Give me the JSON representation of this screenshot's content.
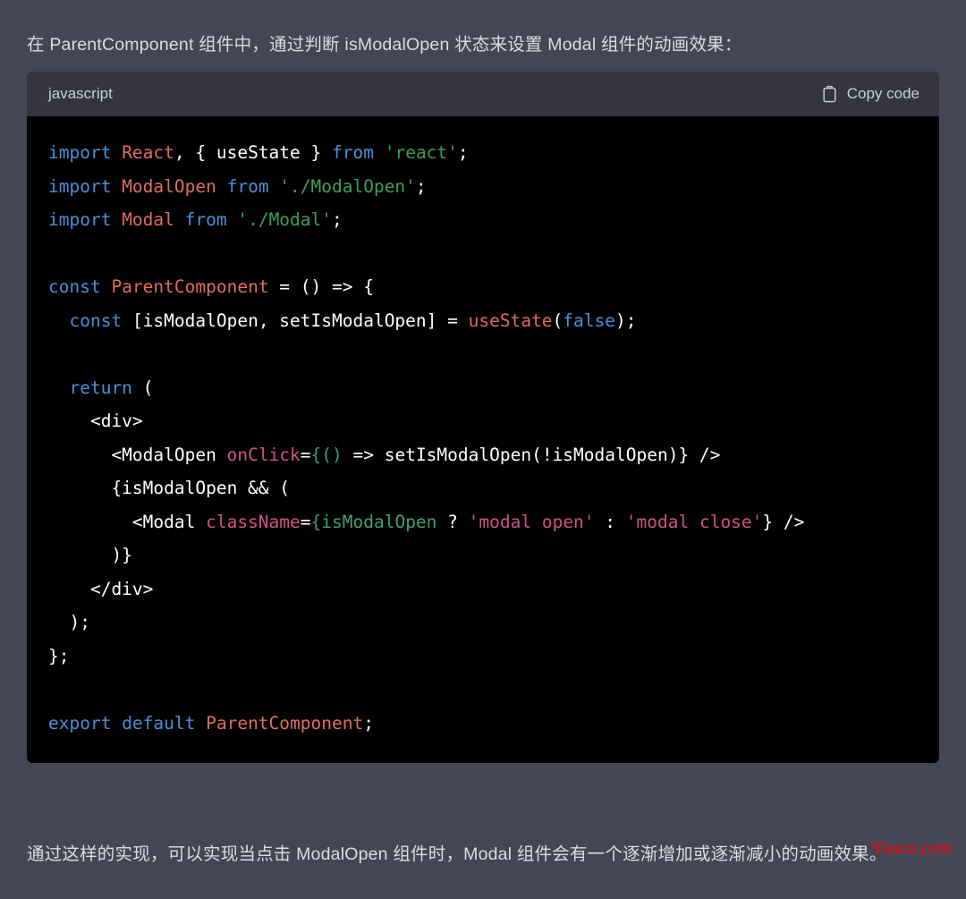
{
  "theme": {
    "page_background": "#444654",
    "code_header_background": "#343541",
    "code_body_background": "#000000",
    "prose_color": "#d9dce3",
    "keyword_color": "#4a90d9",
    "identifier_color": "#e06c5f",
    "string_color": "#3f9f55",
    "attribute_color": "#d1508a",
    "expression_color": "#3fa06e",
    "watermark_color": "#ff0000"
  },
  "intro": {
    "text": "在 ParentComponent 组件中，通过判断 isModalOpen 状态来设置 Modal 组件的动画效果："
  },
  "code_block": {
    "language_label": "javascript",
    "copy_label": "Copy code",
    "copy_icon": "clipboard-icon",
    "lines": [
      [
        {
          "t": "import ",
          "c": "kw"
        },
        {
          "t": "React",
          "c": "id"
        },
        {
          "t": ", { ",
          "c": "pl"
        },
        {
          "t": "useState",
          "c": "pl"
        },
        {
          "t": " } ",
          "c": "pl"
        },
        {
          "t": "from ",
          "c": "kw"
        },
        {
          "t": "'react'",
          "c": "str"
        },
        {
          "t": ";",
          "c": "pl"
        }
      ],
      [
        {
          "t": "import ",
          "c": "kw"
        },
        {
          "t": "ModalOpen ",
          "c": "id"
        },
        {
          "t": "from ",
          "c": "kw"
        },
        {
          "t": "'./ModalOpen'",
          "c": "str"
        },
        {
          "t": ";",
          "c": "pl"
        }
      ],
      [
        {
          "t": "import ",
          "c": "kw"
        },
        {
          "t": "Modal ",
          "c": "id"
        },
        {
          "t": "from ",
          "c": "kw"
        },
        {
          "t": "'./Modal'",
          "c": "str"
        },
        {
          "t": ";",
          "c": "pl"
        }
      ],
      [],
      [
        {
          "t": "const ",
          "c": "kw"
        },
        {
          "t": "ParentComponent",
          "c": "id"
        },
        {
          "t": " = () => {",
          "c": "pl"
        }
      ],
      [
        {
          "t": "  ",
          "c": "pl"
        },
        {
          "t": "const ",
          "c": "kw"
        },
        {
          "t": "[isModalOpen, setIsModalOpen] = ",
          "c": "pl"
        },
        {
          "t": "useState",
          "c": "id"
        },
        {
          "t": "(",
          "c": "pl"
        },
        {
          "t": "false",
          "c": "kw"
        },
        {
          "t": ");",
          "c": "pl"
        }
      ],
      [],
      [
        {
          "t": "  ",
          "c": "pl"
        },
        {
          "t": "return ",
          "c": "kw"
        },
        {
          "t": "(",
          "c": "pl"
        }
      ],
      [
        {
          "t": "    <div>",
          "c": "pl"
        }
      ],
      [
        {
          "t": "      <ModalOpen ",
          "c": "pl"
        },
        {
          "t": "onClick",
          "c": "attr"
        },
        {
          "t": "=",
          "c": "pl"
        },
        {
          "t": "{()",
          "c": "expr"
        },
        {
          "t": " => setIsModalOpen(!isModalOpen)} />",
          "c": "pl"
        }
      ],
      [
        {
          "t": "      {isModalOpen && (",
          "c": "pl"
        }
      ],
      [
        {
          "t": "        <Modal ",
          "c": "pl"
        },
        {
          "t": "className",
          "c": "attr"
        },
        {
          "t": "=",
          "c": "pl"
        },
        {
          "t": "{isModalOpen",
          "c": "expr"
        },
        {
          "t": " ? ",
          "c": "pl"
        },
        {
          "t": "'modal open'",
          "c": "attr"
        },
        {
          "t": " : ",
          "c": "pl"
        },
        {
          "t": "'modal close'",
          "c": "attr"
        },
        {
          "t": "} />",
          "c": "pl"
        }
      ],
      [
        {
          "t": "      )}",
          "c": "pl"
        }
      ],
      [
        {
          "t": "    </div>",
          "c": "pl"
        }
      ],
      [
        {
          "t": "  );",
          "c": "pl"
        }
      ],
      [
        {
          "t": "};",
          "c": "pl"
        }
      ],
      [],
      [
        {
          "t": "export ",
          "c": "kw"
        },
        {
          "t": "default ",
          "c": "kw"
        },
        {
          "t": "ParentComponent",
          "c": "id"
        },
        {
          "t": ";",
          "c": "pl"
        }
      ]
    ]
  },
  "outro": {
    "text": "通过这样的实现，可以实现当点击 ModalOpen 组件时，Modal 组件会有一个逐渐增加或逐渐减小的动画效果。"
  },
  "watermark": {
    "text": "Yuucn.com"
  }
}
